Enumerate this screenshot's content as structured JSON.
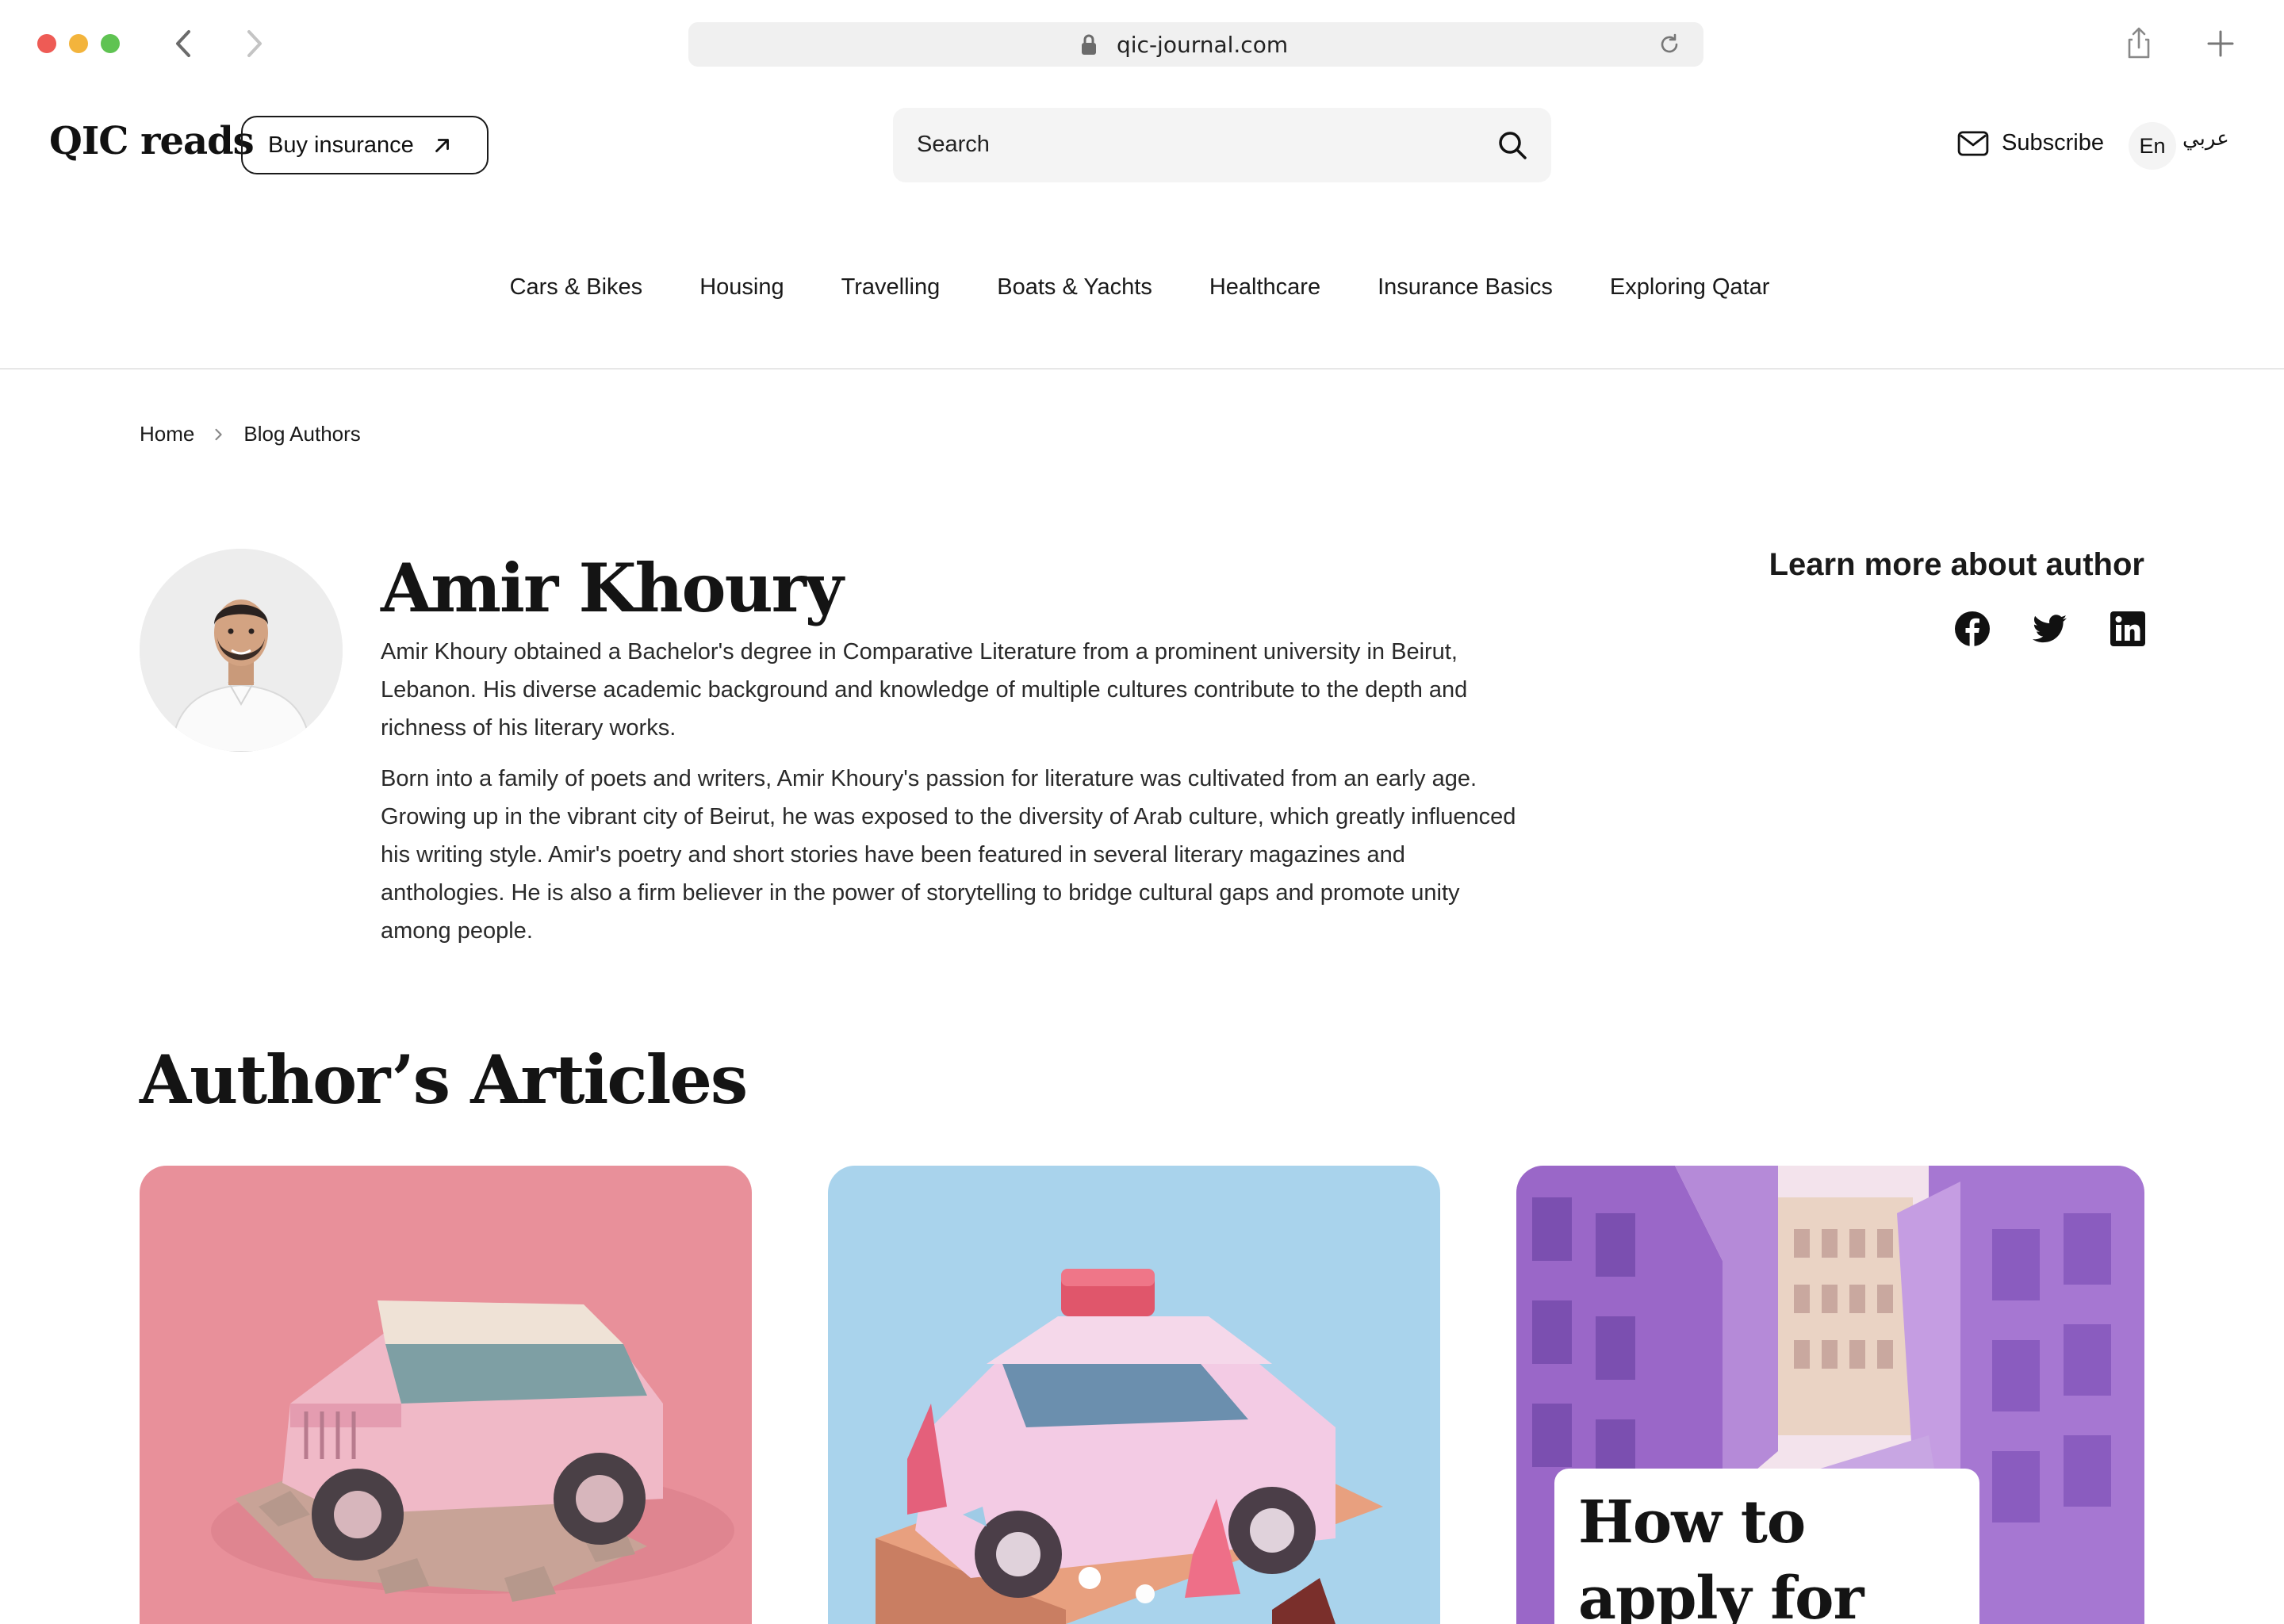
{
  "browser": {
    "url": "qic-journal.com"
  },
  "header": {
    "logo": "QIC reads",
    "buy_label": "Buy insurance",
    "search_placeholder": "Search",
    "subscribe_label": "Subscribe",
    "lang_en": "En",
    "lang_ar": "عربي"
  },
  "nav": {
    "items": [
      "Cars & Bikes",
      "Housing",
      "Travelling",
      "Boats & Yachts",
      "Healthcare",
      "Insurance Basics",
      "Exploring Qatar"
    ]
  },
  "breadcrumb": {
    "home": "Home",
    "current": "Blog Authors"
  },
  "author": {
    "name": "Amir Khoury",
    "bio_1": "Amir Khoury obtained a Bachelor's degree in Comparative Literature from a prominent university in Beirut, Lebanon. His diverse academic background and knowledge of multiple cultures contribute to the depth and richness of his literary works.",
    "bio_2": "Born into a family of poets and writers, Amir Khoury's passion for literature was cultivated from an early age. Growing up in the vibrant city of Beirut, he was exposed to the diversity of Arab culture, which greatly influenced his writing style. Amir's poetry and short stories have been featured in several literary magazines and anthologies. He is also a firm believer in the power of storytelling to bridge cultural gaps and promote unity among people.",
    "learn_more": "Learn more about author",
    "social_icons": [
      "facebook-icon",
      "twitter-icon",
      "linkedin-icon"
    ]
  },
  "articles": {
    "title": "Author’s Articles",
    "cards": [
      {
        "image": "pink-jeep-on-rocks-illustration",
        "caption": ""
      },
      {
        "image": "pink-taxi-car-illustration",
        "caption": ""
      },
      {
        "image": "purple-city-street-illustration",
        "caption": "How to apply for family visit"
      }
    ]
  },
  "colors": {
    "card1_bg": "#e8909a",
    "card2_bg": "#a9d3ec",
    "card3_bg": "#b58ad8",
    "text": "#141414"
  }
}
